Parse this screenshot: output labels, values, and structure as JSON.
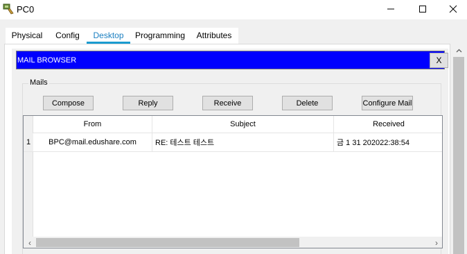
{
  "window": {
    "title": "PC0",
    "icon": "network-device-icon",
    "controls": [
      "minimize-icon",
      "maximize-icon",
      "close-icon"
    ]
  },
  "tabs": [
    {
      "label": "Physical",
      "active": false
    },
    {
      "label": "Config",
      "active": false
    },
    {
      "label": "Desktop",
      "active": true
    },
    {
      "label": "Programming",
      "active": false
    },
    {
      "label": "Attributes",
      "active": false
    }
  ],
  "mail_browser": {
    "title": "MAIL BROWSER",
    "close_label": "X",
    "header_color": "#0000ff",
    "group_label": "Mails",
    "buttons": {
      "compose": "Compose",
      "reply": "Reply",
      "receive": "Receive",
      "delete": "Delete",
      "configure": "Configure Mail"
    },
    "table": {
      "columns": [
        "From",
        "Subject",
        "Received"
      ],
      "rows": [
        {
          "num": "1",
          "from": "BPC@mail.edushare.com",
          "subject": "RE: 테스트 테스트",
          "received": "금 1 31 202022:38:54"
        }
      ]
    }
  },
  "colors": {
    "active_tab_underline": "#1a9bd0",
    "active_tab_text": "#1a7fc1"
  }
}
